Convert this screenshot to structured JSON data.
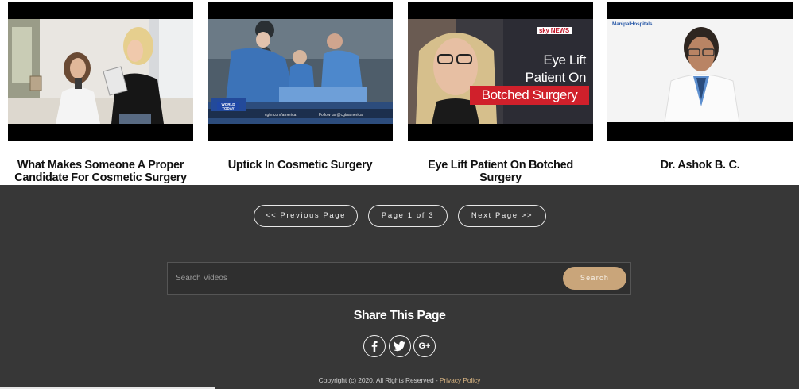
{
  "videos": [
    {
      "title": "What Makes Someone A Proper Candidate For Cosmetic Surgery"
    },
    {
      "title": "Uptick In Cosmetic Surgery",
      "overlay": {
        "logo": "WORLD TODAY",
        "ticker_left": "cgtn.com/america",
        "ticker_right": "Follow us @cgtnamerica"
      }
    },
    {
      "title": "Eye Lift Patient On Botched Surgery",
      "overlay": {
        "brand": "sky NEWS",
        "line1": "Eye Lift",
        "line2": "Patient On",
        "line3": "Botched Surgery"
      }
    },
    {
      "title": "Dr. Ashok B. C.",
      "overlay": {
        "brand": "ManipalHospitals"
      }
    }
  ],
  "pagination": {
    "previous_label": "<< Previous Page",
    "status_label": "Page 1 of 3",
    "next_label": "Next Page >>"
  },
  "search": {
    "placeholder": "Search Videos",
    "button_label": "Search"
  },
  "share": {
    "title": "Share This Page",
    "icons": [
      {
        "name": "facebook-icon",
        "glyph": "f"
      },
      {
        "name": "twitter-icon",
        "glyph": "t"
      },
      {
        "name": "google-plus-icon",
        "glyph": "G+"
      }
    ]
  },
  "footer": {
    "copyright": "Copyright (c) 2020. All Rights Reserved - ",
    "privacy_link": "Privacy Policy"
  },
  "colors": {
    "footer_bg": "#373737",
    "search_button": "#c9a57a",
    "privacy_link": "#d8b482",
    "sky_red": "#d0202b"
  }
}
